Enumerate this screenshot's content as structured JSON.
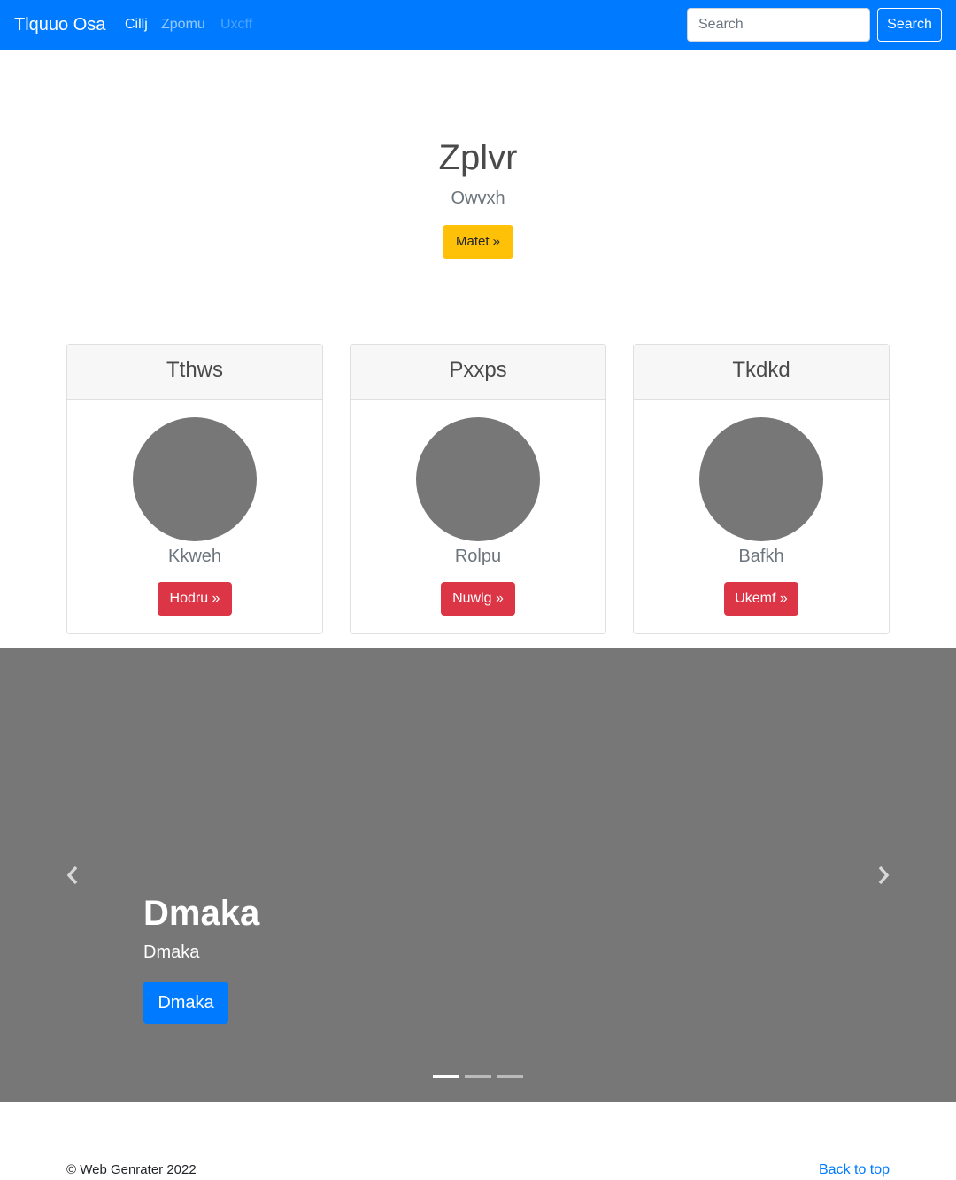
{
  "navbar": {
    "brand": "Tlquuo Osa",
    "links": [
      {
        "label": "Cillj",
        "state": "active"
      },
      {
        "label": "Zpomu",
        "state": "normal"
      },
      {
        "label": "Uxcff",
        "state": "disabled"
      }
    ],
    "search": {
      "placeholder": "Search",
      "button_label": "Search"
    },
    "background_color": "#007bff"
  },
  "hero": {
    "title": "Zplvr",
    "subtitle": "Owvxh",
    "button_label": "Matet »",
    "button_color": "#ffc107"
  },
  "cards": [
    {
      "header": "Tthws",
      "text": "Kkweh",
      "button_label": "Hodru »"
    },
    {
      "header": "Pxxps",
      "text": "Rolpu",
      "button_label": "Nuwlg »"
    },
    {
      "header": "Tkdkd",
      "text": "Bafkh",
      "button_label": "Ukemf »"
    }
  ],
  "card_button_color": "#dc3545",
  "carousel": {
    "title": "Dmaka",
    "text": "Dmaka",
    "button_label": "Dmaka",
    "prev_icon": "chevron-left-icon",
    "next_icon": "chevron-right-icon",
    "slide_count": 3,
    "active_slide": 1,
    "background_color": "#777777"
  },
  "footer": {
    "copyright": "© Web Genrater 2022",
    "back_to_top": "Back to top"
  }
}
